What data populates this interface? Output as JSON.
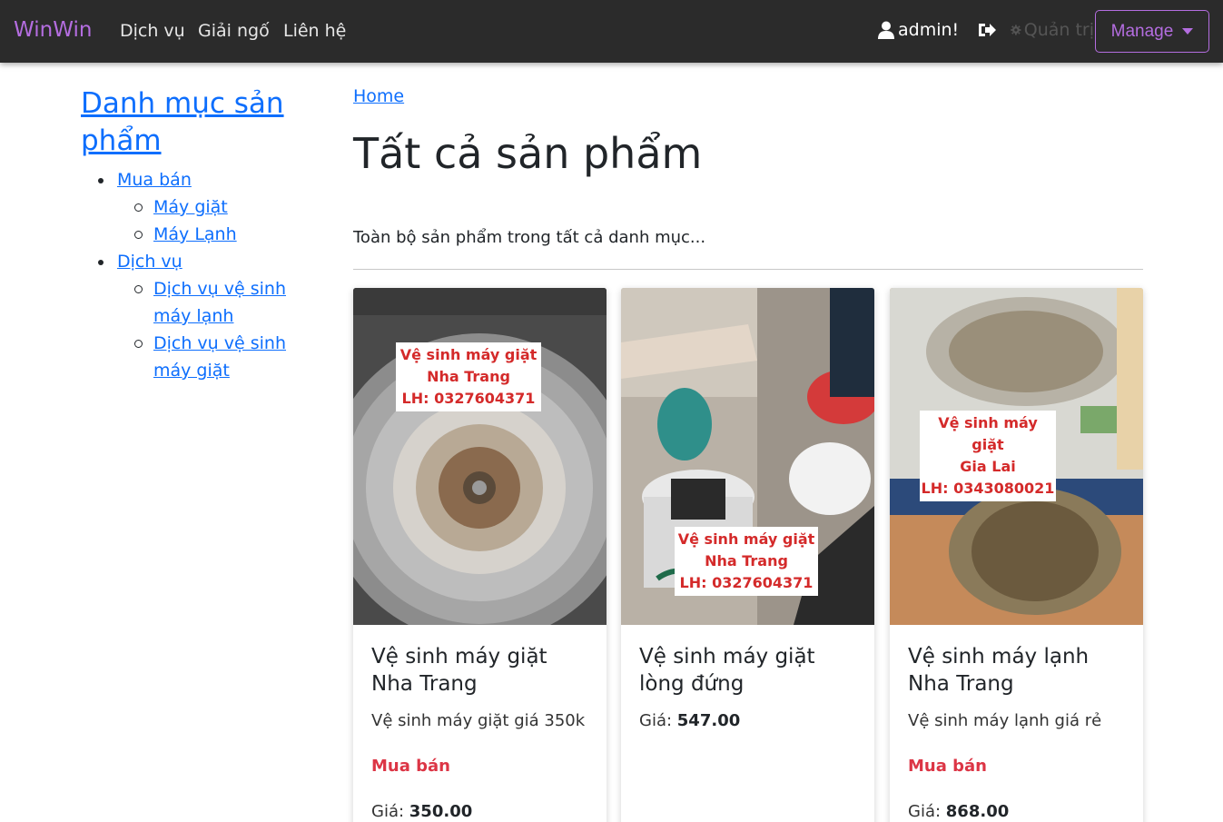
{
  "navbar": {
    "brand": "WinWin",
    "links": [
      "Dịch vụ",
      "Giải ngố",
      "Liên hệ"
    ],
    "user": "admin!",
    "admin_label": "Quản trị",
    "manage": "Manage"
  },
  "sidebar": {
    "title": "Danh mục sản phẩm",
    "groups": [
      {
        "label": "Mua bán",
        "children": [
          "Máy giặt",
          "Máy Lạnh"
        ]
      },
      {
        "label": "Dịch vụ",
        "children": [
          "Dịch vụ vệ sinh máy lạnh",
          "Dịch vụ vệ sinh máy giặt"
        ]
      }
    ]
  },
  "main": {
    "breadcrumb": "Home",
    "title": "Tất cả sản phẩm",
    "description": "Toàn bộ sản phẩm trong tất cả danh mục...",
    "price_prefix": "Giá:",
    "products": [
      {
        "image_caption": [
          "Vệ sinh máy giặt",
          "Nha Trang",
          "LH: 0327604371"
        ],
        "title": "Vệ sinh máy giặt Nha Trang",
        "subtitle": "Vệ sinh máy giặt giá 350k",
        "category": "Mua bán",
        "price": "350.00"
      },
      {
        "image_caption": [
          "Vệ sinh máy giặt",
          "Nha Trang",
          "LH: 0327604371"
        ],
        "title": "Vệ sinh máy giặt lòng đứng",
        "subtitle": "",
        "category": "",
        "price": "547.00"
      },
      {
        "image_caption": [
          "Vệ sinh máy giặt",
          "Gia Lai",
          "LH: 0343080021"
        ],
        "title": "Vệ sinh máy lạnh Nha Trang",
        "subtitle": "Vệ sinh máy lạnh giá rẻ",
        "category": "Mua bán",
        "price": "868.00"
      }
    ]
  },
  "colors": {
    "navbar_bg": "#2b2b2b",
    "brand": "#b46de0",
    "link": "#0d6efd",
    "category": "#dc3545",
    "caption_text": "#d42a2a"
  }
}
